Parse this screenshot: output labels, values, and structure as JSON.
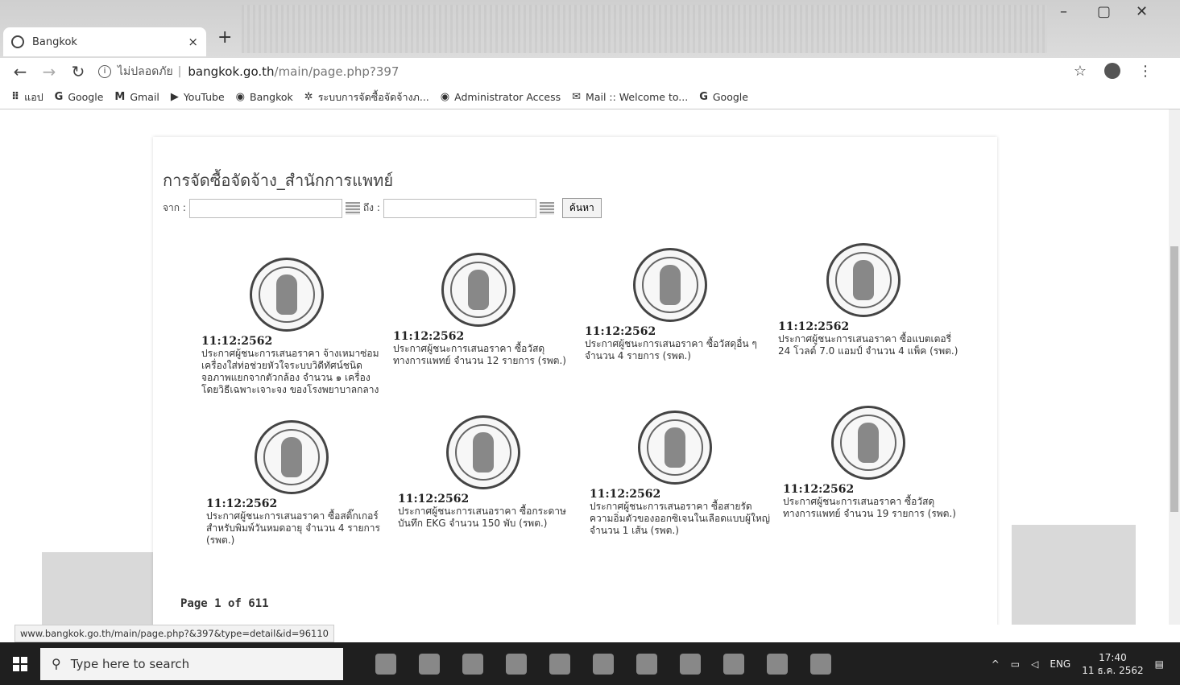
{
  "browser": {
    "tab_title": "Bangkok",
    "tab_close": "×",
    "new_tab": "+",
    "win_min": "–",
    "win_max": "▢",
    "win_close": "✕",
    "security_label": "ไม่ปลอดภัย",
    "url_domain": "bangkok.go.th",
    "url_path": "/main/page.php?397",
    "bookmarks": [
      {
        "icon": "apps-icon",
        "label": "แอป"
      },
      {
        "icon": "google-icon",
        "label": "Google"
      },
      {
        "icon": "gmail-icon",
        "label": "Gmail"
      },
      {
        "icon": "youtube-icon",
        "label": "YouTube"
      },
      {
        "icon": "globe-icon",
        "label": "Bangkok"
      },
      {
        "icon": "system-icon",
        "label": "ระบบการจัดซื้อจัดจ้างภ..."
      },
      {
        "icon": "globe-icon",
        "label": "Administrator Access"
      },
      {
        "icon": "mail-icon",
        "label": "Mail :: Welcome to..."
      },
      {
        "icon": "google-icon",
        "label": "Google"
      }
    ]
  },
  "page": {
    "title": "การจัดซื้อจัดจ้าง_สำนักการแพทย์",
    "from_label": "จาก :",
    "to_label": "ถึง :",
    "search_button": "ค้นหา",
    "items": [
      {
        "date": "11:12:2562",
        "desc": "ประกาศผู้ชนะการเสนอราคา จ้างเหมาซ่อมเครื่องใส่ท่อช่วยหัวใจระบบวิดีทัศน์ชนิดจอภาพแยกจากตัวกล้อง จำนวน ๑ เครื่อง โดยวิธีเฉพาะเจาะจง ของโรงพยาบาลกลาง"
      },
      {
        "date": "11:12:2562",
        "desc": "ประกาศผู้ชนะการเสนอราคา ซื้อวัสดุทางการแพทย์ จำนวน 12 รายการ (รพต.)"
      },
      {
        "date": "11:12:2562",
        "desc": "ประกาศผู้ชนะการเสนอราคา ซื้อวัสดุอื่น ๆ จำนวน 4 รายการ (รพต.)"
      },
      {
        "date": "11:12:2562",
        "desc": "ประกาศผู้ชนะการเสนอราคา ซื้อแบตเตอรี่ 24 โวลต์ 7.0 แอมป์ จำนวน 4 แพ็ค (รพต.)"
      },
      {
        "date": "11:12:2562",
        "desc": "ประกาศผู้ชนะการเสนอราคา ซื้อสติ๊กเกอร์สำหรับพิมพ์วันหมดอายุ จำนวน 4 รายการ (รพต.)"
      },
      {
        "date": "11:12:2562",
        "desc": "ประกาศผู้ชนะการเสนอราคา ซื้อกระดาษบันทึก EKG จำนวน 150 พับ (รพต.)"
      },
      {
        "date": "11:12:2562",
        "desc": "ประกาศผู้ชนะการเสนอราคา ซื้อสายรัดความอิ่มตัวของออกซิเจนในเลือดแบบผู้ใหญ่ จำนวน 1 เส้น (รพต.)"
      },
      {
        "date": "11:12:2562",
        "desc": "ประกาศผู้ชนะการเสนอราคา ซื้อวัสดุทางการแพทย์ จำนวน 19 รายการ (รพต.)"
      }
    ],
    "pager": "Page 1 of 611"
  },
  "status_url": "www.bangkok.go.th/main/page.php?&397&type=detail&id=96110",
  "taskbar": {
    "search_placeholder": "Type here to search",
    "lang": "ENG",
    "time": "17:40",
    "date": "11 ธ.ค. 2562"
  }
}
